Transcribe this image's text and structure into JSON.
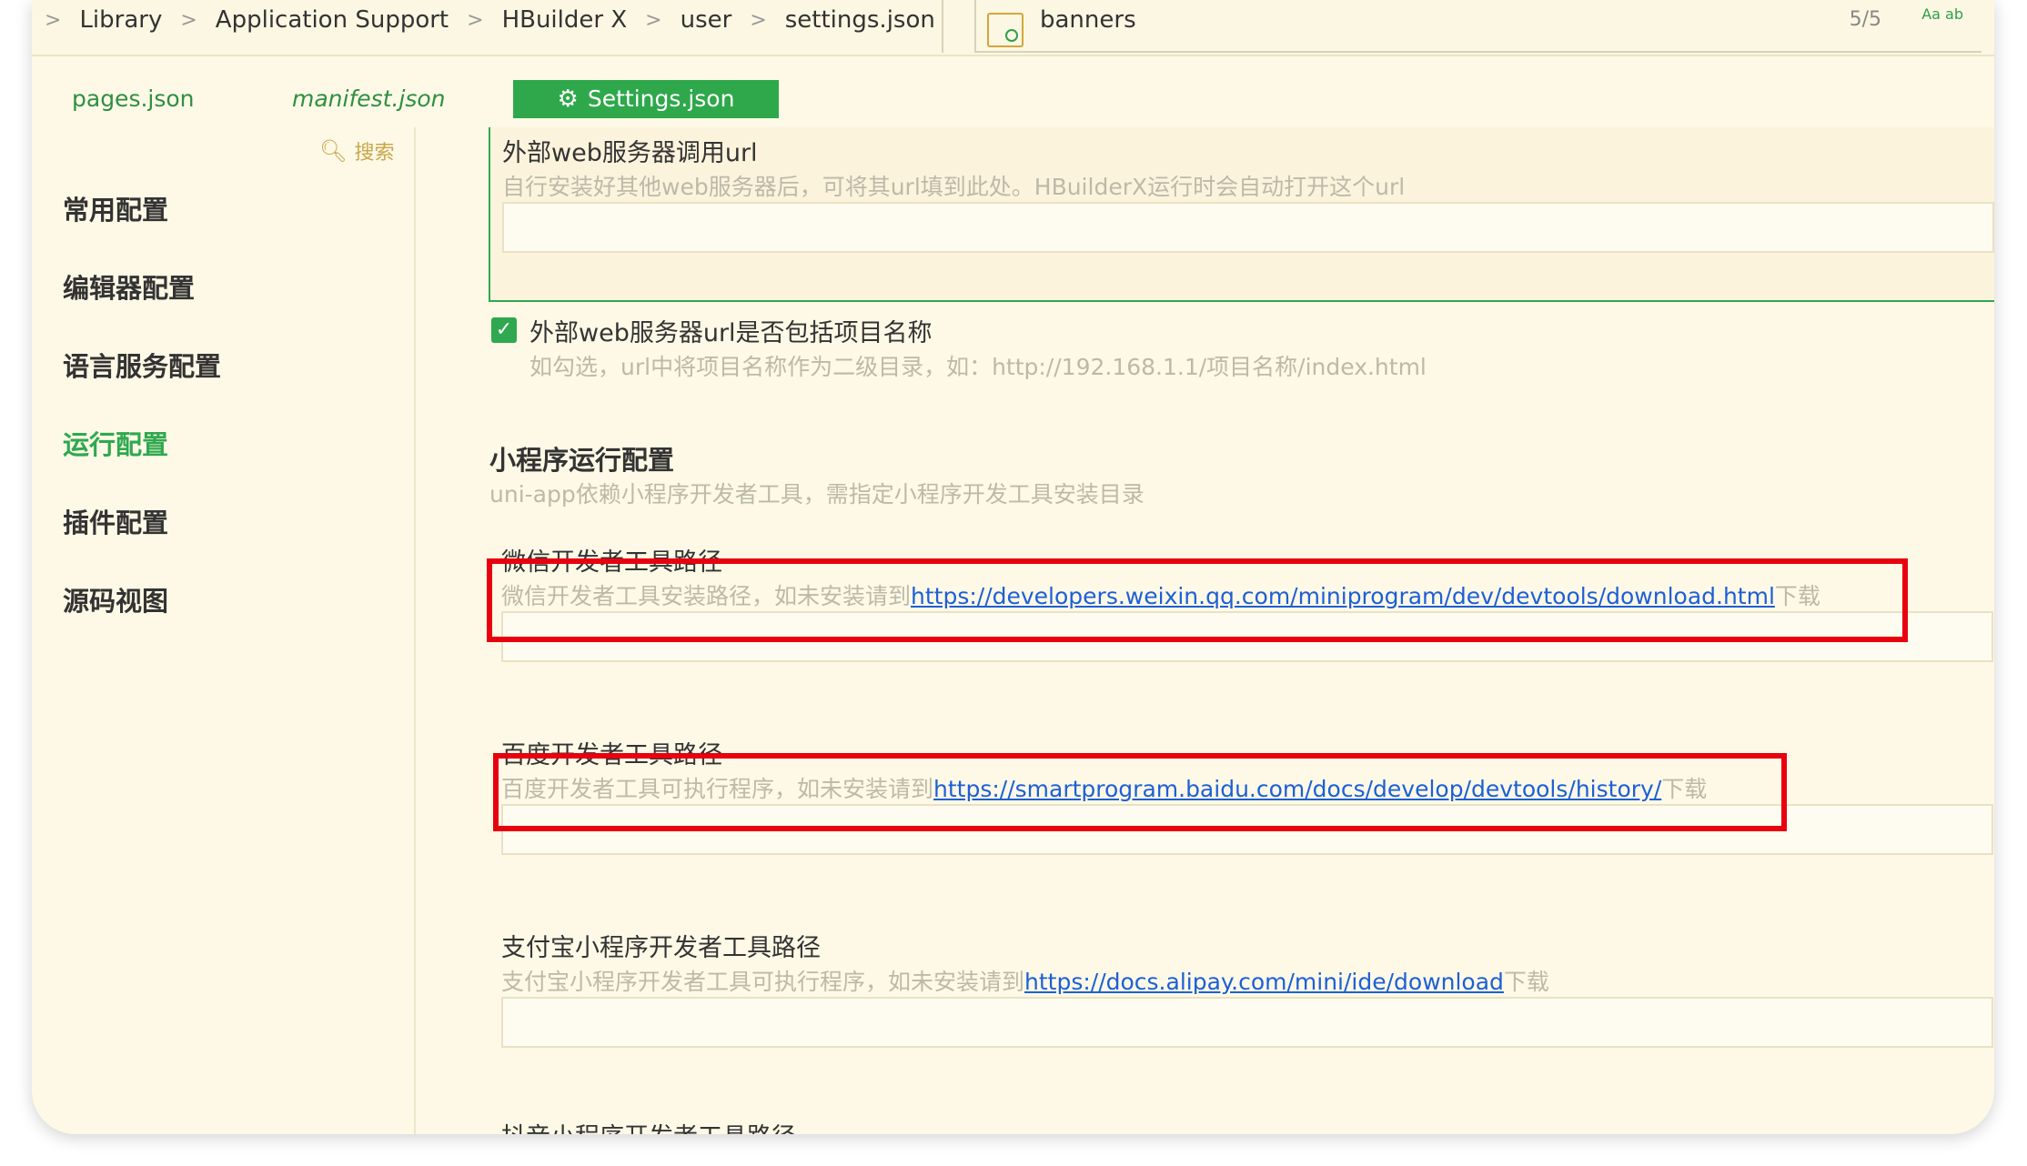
{
  "path": {
    "crumbs": [
      "Library",
      "Application Support",
      "HBuilder X",
      "user",
      "settings.json"
    ],
    "separator": ">",
    "find_text": "banners",
    "find_count": "5/5",
    "find_options": "Aa ab"
  },
  "tabs": [
    {
      "label": "pages.json"
    },
    {
      "label": "manifest.json"
    },
    {
      "label": "Settings.json"
    }
  ],
  "sidebar": {
    "search_label": "搜索",
    "items": [
      {
        "label": "常用配置"
      },
      {
        "label": "编辑器配置"
      },
      {
        "label": "语言服务配置"
      },
      {
        "label": "运行配置"
      },
      {
        "label": "插件配置"
      },
      {
        "label": "源码视图"
      }
    ]
  },
  "settings": {
    "external_url": {
      "label": "外部web服务器调用url",
      "desc": "自行安装好其他web服务器后，可将其url填到此处。HBuilderX运行时会自动打开这个url",
      "value": ""
    },
    "include_project": {
      "label": "外部web服务器url是否包括项目名称",
      "desc": "如勾选，url中将项目名称作为二级目录，如：http://192.168.1.1/项目名称/index.html",
      "checked": true
    },
    "miniprogram_section": {
      "title": "小程序运行配置",
      "desc": "uni-app依赖小程序开发者工具，需指定小程序开发工具安装目录"
    },
    "weixin": {
      "label": "微信开发者工具路径",
      "desc_prefix": "微信开发者工具安装路径，如未安装请到",
      "link": "https://developers.weixin.qq.com/miniprogram/dev/devtools/download.html",
      "desc_suffix": "下载",
      "value": ""
    },
    "baidu": {
      "label": "百度开发者工具路径",
      "desc_prefix": "百度开发者工具可执行程序，如未安装请到",
      "link": "https://smartprogram.baidu.com/docs/develop/devtools/history/",
      "desc_suffix": "下载",
      "value": ""
    },
    "alipay": {
      "label": "支付宝小程序开发者工具路径",
      "desc_prefix": "支付宝小程序开发者工具可执行程序，如未安装请到",
      "link": "https://docs.alipay.com/mini/ide/download",
      "desc_suffix": "下载",
      "value": ""
    },
    "douyin": {
      "label": "抖音小程序开发者工具路径"
    }
  },
  "colors": {
    "accent": "#2fa84f",
    "highlight": "#e8000f",
    "link": "#1d5fd6"
  }
}
